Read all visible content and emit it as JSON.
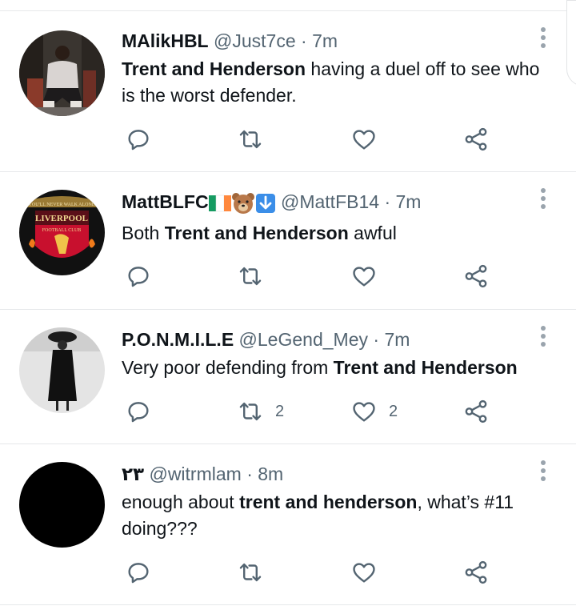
{
  "tweets": [
    {
      "name": "MAlikHBL",
      "handle": "@Just7ce",
      "dot": "·",
      "time": "7m",
      "text_parts": [
        {
          "b": "Trent and Henderson"
        },
        {
          "t": " having a duel off to see who is the worst defender."
        }
      ],
      "retweets": "",
      "likes": ""
    },
    {
      "name": "MattBLFC",
      "handle": "@MattFB14",
      "dot": "·",
      "time": "7m",
      "emoji": [
        "irish-flag-emoji",
        "bear-emoji",
        "down-arrow-emoji"
      ],
      "text_parts": [
        {
          "t": "Both "
        },
        {
          "b": "Trent and Henderson"
        },
        {
          "t": " awful"
        }
      ],
      "retweets": "",
      "likes": ""
    },
    {
      "name": "P.O.N.M.I.L.E",
      "handle": "@LeGend_Mey",
      "dot": "·",
      "time": "7m",
      "text_parts": [
        {
          "t": "Very poor defending from "
        },
        {
          "b": "Trent and Henderson"
        }
      ],
      "retweets": "2",
      "likes": "2"
    },
    {
      "name": "٢٣",
      "handle": "@witrmlam",
      "dot": "·",
      "time": "8m",
      "text_parts": [
        {
          "t": "enough about "
        },
        {
          "b": "trent and henderson"
        },
        {
          "t": ", what’s #11 doing???"
        }
      ],
      "retweets": "",
      "likes": ""
    }
  ],
  "avatar_text": {
    "crest_title": "LIVERPOOL",
    "crest_sub": "FOOTBALL CLUB",
    "crest_motto": "YOU'LL NEVER WALK ALONE"
  },
  "colors": {
    "text": "#0f1419",
    "secondary": "#536471",
    "divider": "#e6e8ea",
    "icon": "#536471"
  }
}
